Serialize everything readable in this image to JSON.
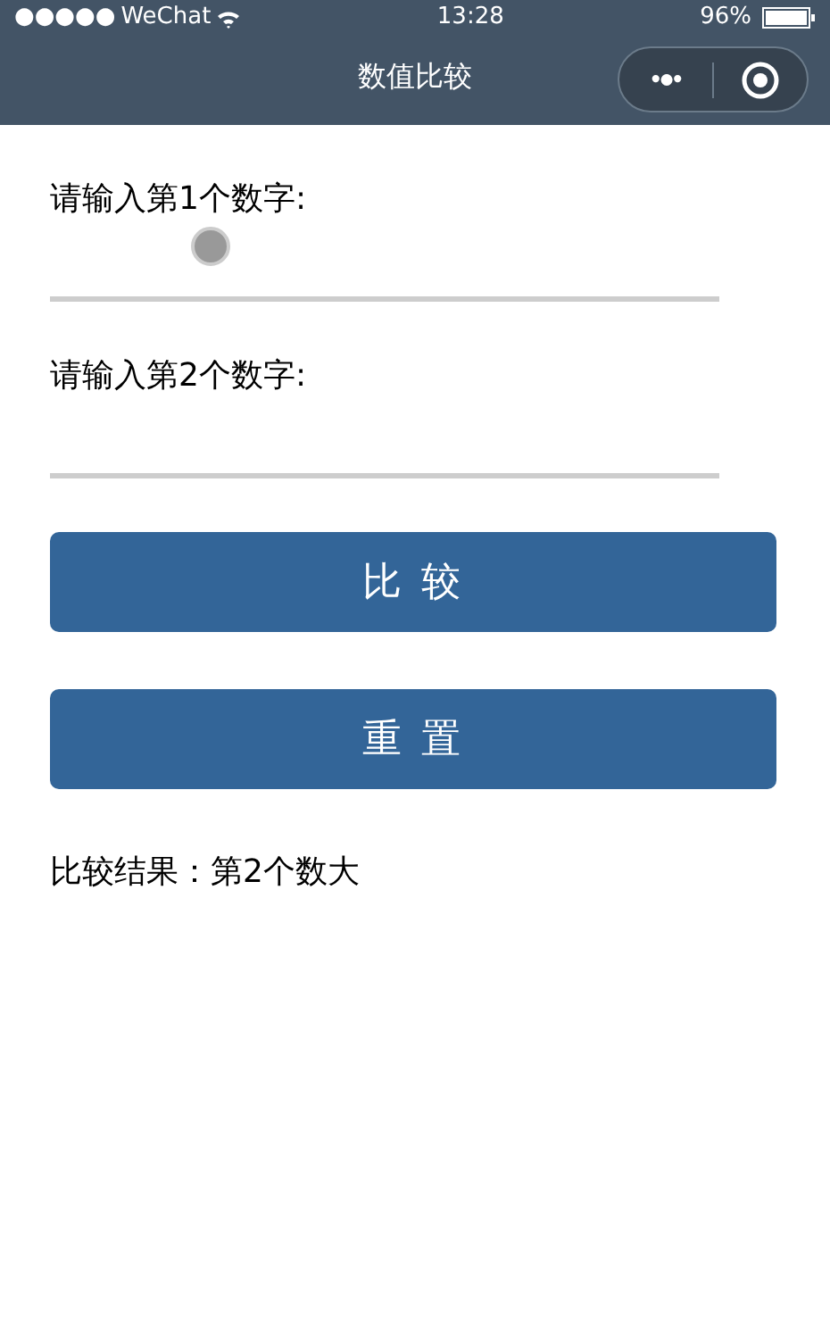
{
  "status_bar": {
    "signal": "●●●●●",
    "carrier": "WeChat",
    "time": "13:28",
    "battery": "96%"
  },
  "nav_bar": {
    "title": "数值比较",
    "menu": "•●•"
  },
  "fields": [
    {
      "label": "请输入第1个数字:",
      "touch_pointer": true
    },
    {
      "label": "请输入第2个数字:",
      "touch_pointer": false
    }
  ],
  "buttons": [
    "比 较",
    "重 置"
  ],
  "result": "比较结果：第2个数大"
}
